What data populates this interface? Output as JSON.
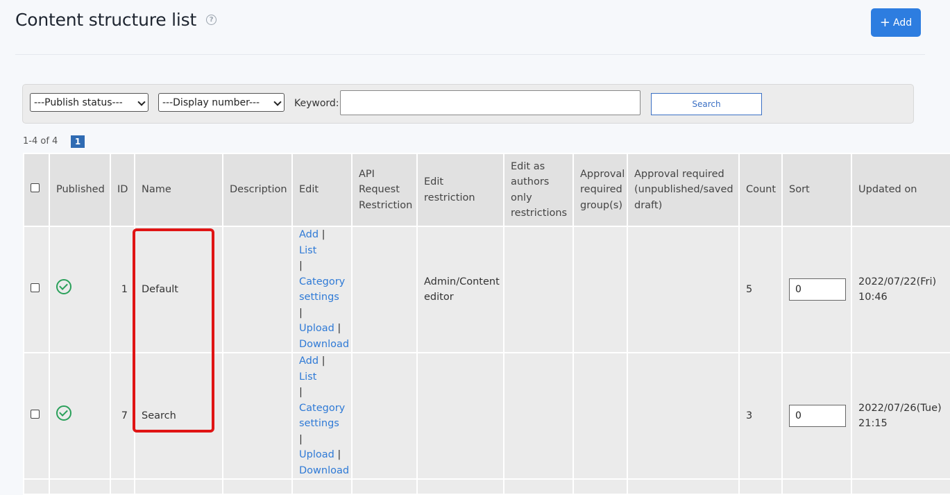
{
  "header": {
    "title": "Content structure list",
    "add_label": "Add"
  },
  "filters": {
    "publish_status": "---Publish status---",
    "display_number": "---Display number---",
    "keyword_label": "Keyword:",
    "keyword_value": "",
    "search_label": "Search"
  },
  "pagination": {
    "range": "1-4 of 4",
    "current_page": "1"
  },
  "table": {
    "headers": {
      "published": "Published",
      "id": "ID",
      "name": "Name",
      "description": "Description",
      "edit": "Edit",
      "api": "API Request Restriction",
      "edit_restriction": "Edit restriction",
      "edit_authors": "Edit as authors only restrictions",
      "approval_group": "Approval required group(s)",
      "approval_required": "Approval required (unpublished/saved draft)",
      "count": "Count",
      "sort": "Sort",
      "updated_on": "Updated on"
    },
    "edit_links": {
      "add": "Add",
      "list": "List",
      "category": "Category settings",
      "upload": "Upload",
      "download": "Download"
    },
    "rows": [
      {
        "id": "1",
        "name": "Default",
        "description": "",
        "edit_restriction": "Admin/Content editor",
        "count": "5",
        "sort": "0",
        "updated_date": "2022/07/22(Fri)",
        "updated_time": "10:46"
      },
      {
        "id": "7",
        "name": "Search",
        "description": "",
        "edit_restriction": "",
        "count": "3",
        "sort": "0",
        "updated_date": "2022/07/26(Tue)",
        "updated_time": "21:15"
      }
    ]
  },
  "colors": {
    "accent": "#2d7de0",
    "link": "#2f7ad6",
    "published": "#2aa05a",
    "highlight": "#e01414"
  }
}
